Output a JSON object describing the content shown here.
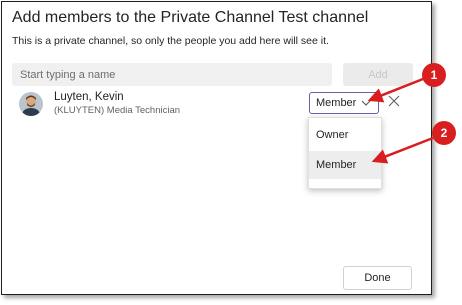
{
  "dialog": {
    "title": "Add members to the Private Channel Test channel",
    "subtitle": "This is a private channel, so only the people you add here will see it.",
    "search_placeholder": "Start typing a name",
    "add_label": "Add",
    "done_label": "Done"
  },
  "member": {
    "name": "Luyten, Kevin",
    "description": "(KLUYTEN) Media Technician",
    "role": "Member"
  },
  "role_dropdown": {
    "options": [
      "Owner",
      "Member"
    ],
    "selected": "Member"
  },
  "annotations": {
    "badge_1": "1",
    "badge_2": "2",
    "color": "#d81e1e"
  },
  "colors": {
    "accent": "#6264a7",
    "annotation_red": "#d81e1e"
  }
}
